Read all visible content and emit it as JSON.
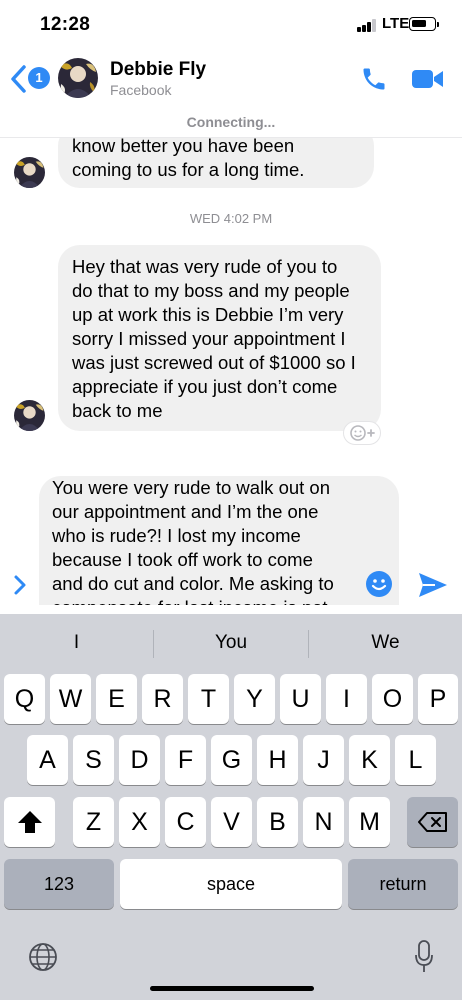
{
  "status_bar": {
    "time": "12:28",
    "network": "LTE",
    "signal_bars_filled": 3,
    "signal_bars_total": 4,
    "battery_level": 0.7
  },
  "header": {
    "back_badge_count": "1",
    "contact_name": "Debbie Fly",
    "contact_subtitle": "Facebook",
    "icons": [
      "chevron-left-icon",
      "phone-icon",
      "video-camera-icon"
    ]
  },
  "connection_status": "Connecting...",
  "conversation": {
    "messages": [
      {
        "sender": "contact",
        "lines": [
          "know better you have been",
          "coming to us for a long time."
        ]
      },
      {
        "type": "timestamp",
        "text": "WED 4:02 PM"
      },
      {
        "sender": "contact",
        "lines": [
          "Hey that was very rude of you to",
          "do that to my boss and my people",
          "up at work this is Debbie I’m very",
          "sorry I missed your appointment I",
          "was just screwed out of $1000 so I",
          "appreciate if you just don’t come",
          "back to me"
        ]
      }
    ]
  },
  "composer": {
    "lines": [
      "You were very rude to walk out on",
      "our appointment and I’m the one",
      "who is rude?! I lost my income",
      "because I took off work to come",
      "and do cut and color. Me asking to",
      "compensate for lost income is not"
    ],
    "icons": [
      "chevron-right-icon",
      "emoji-icon",
      "send-icon"
    ]
  },
  "keyboard": {
    "suggestions": [
      "I",
      "You",
      "We"
    ],
    "row1": [
      "Q",
      "W",
      "E",
      "R",
      "T",
      "Y",
      "U",
      "I",
      "O",
      "P"
    ],
    "row2": [
      "A",
      "S",
      "D",
      "F",
      "G",
      "H",
      "J",
      "K",
      "L"
    ],
    "row3": [
      "Z",
      "X",
      "C",
      "V",
      "B",
      "N",
      "M"
    ],
    "numbers_key": "123",
    "space_key": "space",
    "return_key": "return",
    "icons": [
      "shift-icon",
      "backspace-icon",
      "globe-icon",
      "microphone-icon"
    ]
  },
  "colors": {
    "accent": "#2f8af5",
    "bubble": "#f0f0f0",
    "keyboard_bg": "#d1d3d9",
    "special_key": "#abb0bb"
  }
}
